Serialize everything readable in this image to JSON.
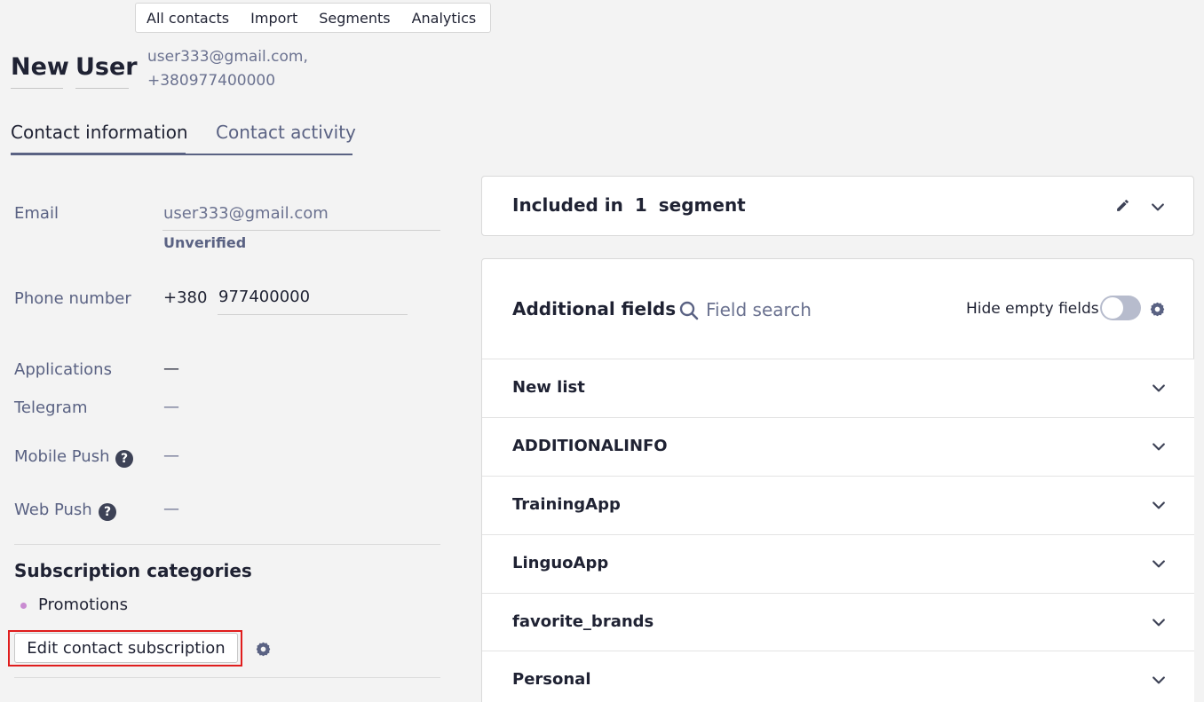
{
  "topnav": {
    "items": [
      "All contacts",
      "Import",
      "Segments",
      "Analytics"
    ]
  },
  "contact": {
    "first_name": "New",
    "last_name": "User",
    "email_line": "user333@gmail.com,",
    "phone_line": "+380977400000"
  },
  "tabs": {
    "info": "Contact information",
    "activity": "Contact activity"
  },
  "fields": {
    "email_label": "Email",
    "email_value": "user333@gmail.com",
    "email_status": "Unverified",
    "phone_label": "Phone number",
    "phone_code": "+380",
    "phone_value": "977400000",
    "applications_label": "Applications",
    "applications_value": "—",
    "telegram_label": "Telegram",
    "telegram_value": "—",
    "mobile_push_label": "Mobile Push",
    "mobile_push_value": "—",
    "web_push_label": "Web Push",
    "web_push_value": "—",
    "help_glyph": "?"
  },
  "subscriptions": {
    "title": "Subscription categories",
    "items": [
      "Promotions"
    ],
    "edit_button": "Edit contact subscription"
  },
  "segments": {
    "prefix": "Included in",
    "count": "1",
    "suffix": "segment"
  },
  "additional": {
    "title": "Additional fields",
    "search_placeholder": "Field search",
    "hide_empty_label": "Hide empty fields",
    "hide_empty_on": false,
    "groups": [
      "New list",
      "ADDITIONALINFO",
      "TrainingApp",
      "LinguoApp",
      "favorite_brands",
      "Personal"
    ]
  },
  "colors": {
    "accent": "#5a6283",
    "highlight_border": "#e01d1d",
    "bullet": "#c98bd1"
  }
}
